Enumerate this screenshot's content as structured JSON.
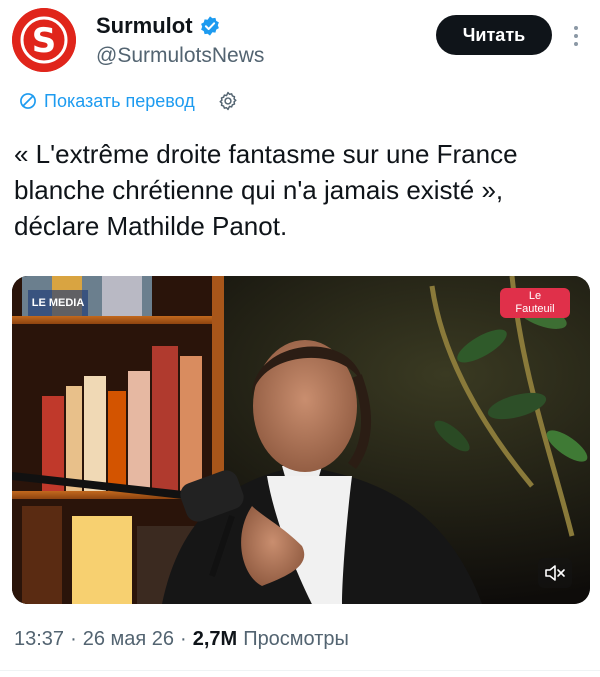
{
  "account": {
    "display_name": "Surmulot",
    "handle": "@SurmulotsNews",
    "avatar_letter": "S",
    "avatar_color": "#e0251b",
    "verified_color": "#1d9bf0"
  },
  "actions": {
    "read_label": "Читать"
  },
  "translate": {
    "label": "Показать перевод"
  },
  "tweet": {
    "text": "« L'extrême droite fantasme sur une France blanche chrétienne qui n'a jamais existé », déclare Mathilde Panot."
  },
  "media": {
    "watermark_left": "LE MEDIA",
    "watermark_right_top": "Le",
    "watermark_right_bottom": "Fauteuil",
    "mute_icon": "volume-muted-icon"
  },
  "meta": {
    "time": "13:37",
    "sep1": "·",
    "date": "26 мая 26",
    "sep2": "·",
    "views_count": "2,7M",
    "views_label": "Просмотры"
  },
  "colors": {
    "accent": "#1d9bf0",
    "text": "#0f1419",
    "secondary": "#536471"
  }
}
